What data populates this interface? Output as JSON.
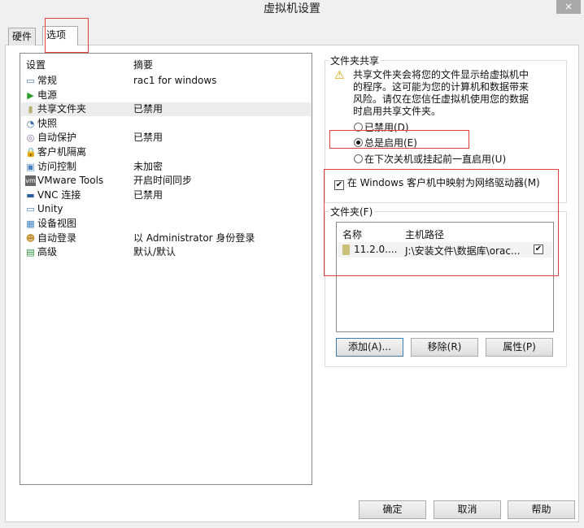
{
  "window": {
    "title": "虚拟机设置",
    "close_icon": "×"
  },
  "tabs": [
    {
      "label": "硬件"
    },
    {
      "label": "选项",
      "selected": true
    }
  ],
  "settings_list": {
    "col_setting": "设置",
    "col_summary": "摘要",
    "rows": [
      {
        "name": "常规",
        "summary": "rac1 for windows",
        "icon": "monitor-icon"
      },
      {
        "name": "电源",
        "summary": "",
        "icon": "play-icon"
      },
      {
        "name": "共享文件夹",
        "summary": "已禁用",
        "icon": "folder-icon",
        "selected": true
      },
      {
        "name": "快照",
        "summary": "",
        "icon": "snapshot-icon"
      },
      {
        "name": "自动保护",
        "summary": "已禁用",
        "icon": "clock-icon"
      },
      {
        "name": "客户机隔离",
        "summary": "",
        "icon": "lock-icon"
      },
      {
        "name": "访问控制",
        "summary": "未加密",
        "icon": "access-icon"
      },
      {
        "name": "VMware Tools",
        "summary": "开启时间同步",
        "icon": "vm-icon"
      },
      {
        "name": "VNC 连接",
        "summary": "已禁用",
        "icon": "vnc-icon"
      },
      {
        "name": "Unity",
        "summary": "",
        "icon": "unity-icon"
      },
      {
        "name": "设备视图",
        "summary": "",
        "icon": "device-view-icon"
      },
      {
        "name": "自动登录",
        "summary": "以 Administrator 身份登录",
        "icon": "users-icon"
      },
      {
        "name": "高级",
        "summary": "默认/默认",
        "icon": "advanced-icon"
      }
    ]
  },
  "sharing": {
    "group_label": "文件夹共享",
    "warning": "共享文件夹会将您的文件显示给虚拟机中的程序。这可能为您的计算机和数据带来风险。请仅在您信任虚拟机使用您的数据时启用共享文件夹。",
    "options": [
      {
        "label": "已禁用(D)",
        "checked": false
      },
      {
        "label": "总是启用(E)",
        "checked": true
      },
      {
        "label": "在下次关机或挂起前一直启用(U)",
        "checked": false
      }
    ],
    "map_drive": {
      "label": "在 Windows 客户机中映射为网络驱动器(M)",
      "checked": true
    }
  },
  "folders": {
    "group_label": "文件夹(F)",
    "col_name": "名称",
    "col_path": "主机路径",
    "rows": [
      {
        "name": "11.2.0....",
        "path": "J:\\安装文件\\数据库\\orac...",
        "enabled": true
      }
    ],
    "add": "添加(A)...",
    "remove": "移除(R)",
    "properties": "属性(P)"
  },
  "footer": {
    "ok": "确定",
    "cancel": "取消",
    "help": "帮助"
  },
  "colors": {
    "annotation": "#e0403a"
  }
}
